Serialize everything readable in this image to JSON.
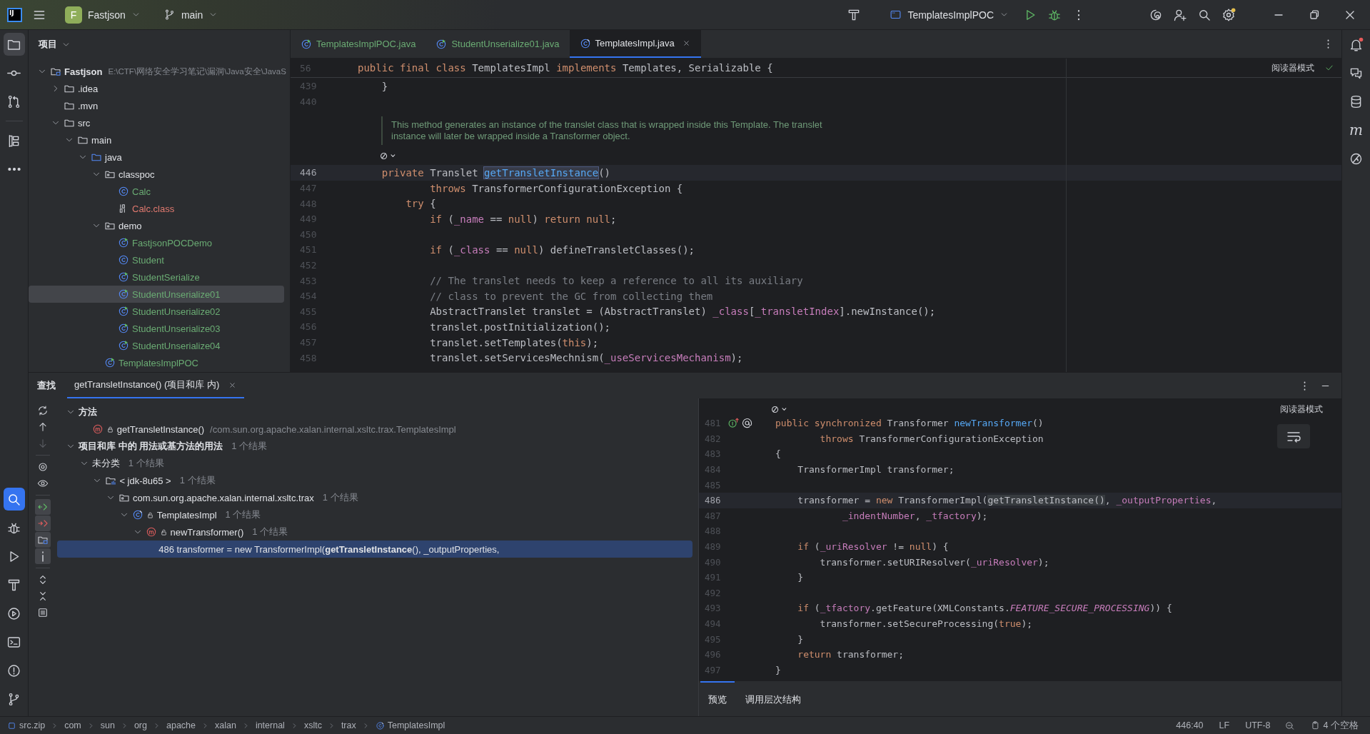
{
  "title_bar": {
    "logo": "IJ",
    "project_initial": "F",
    "project": "Fastjson",
    "branch": "main",
    "run_configuration": "TemplatesImplPOC",
    "settings_badge": true
  },
  "left_toolbar": {
    "top": [
      {
        "kind": "project",
        "selected": true
      },
      {
        "kind": "commit",
        "selected": false
      },
      {
        "kind": "pull-requests",
        "selected": false
      },
      {
        "kind": "structure",
        "selected": false
      },
      {
        "kind": "more",
        "selected": false
      }
    ],
    "bottom": [
      {
        "kind": "find",
        "selected": true
      },
      {
        "kind": "debug",
        "selected": false
      },
      {
        "kind": "run",
        "selected": false
      },
      {
        "kind": "build",
        "selected": false
      },
      {
        "kind": "services",
        "selected": false
      },
      {
        "kind": "terminal",
        "selected": false
      },
      {
        "kind": "problems",
        "selected": false
      },
      {
        "kind": "git",
        "selected": false
      }
    ]
  },
  "project_panel": {
    "title": "项目",
    "tree": [
      {
        "label": "Fastjson",
        "path": "E:\\CTF\\网络安全学习笔记\\漏洞\\Java安全\\JavaS",
        "kind": "module",
        "expanded": true,
        "selected": false,
        "children": [
          {
            "label": ".idea",
            "kind": "folder",
            "expanded": false,
            "selected": false
          },
          {
            "label": ".mvn",
            "kind": "folder",
            "selected": false
          },
          {
            "label": "src",
            "kind": "folder",
            "expanded": true,
            "selected": false,
            "children": [
              {
                "label": "main",
                "kind": "folder",
                "expanded": true,
                "selected": false,
                "children": [
                  {
                    "label": "java",
                    "kind": "source-folder",
                    "expanded": true,
                    "selected": false,
                    "children": [
                      {
                        "label": "classpoc",
                        "kind": "package",
                        "expanded": true,
                        "selected": false,
                        "children": [
                          {
                            "label": "Calc",
                            "kind": "class",
                            "selected": false,
                            "color": "#6aab73"
                          },
                          {
                            "label": "Calc.class",
                            "kind": "binary",
                            "selected": false,
                            "color": "#e0796f"
                          }
                        ]
                      },
                      {
                        "label": "demo",
                        "kind": "package",
                        "expanded": true,
                        "selected": false,
                        "children": [
                          {
                            "label": "FastjsonPOCDemo",
                            "kind": "runnable-class",
                            "selected": false,
                            "color": "#6aab73"
                          },
                          {
                            "label": "Student",
                            "kind": "class",
                            "selected": false,
                            "color": "#6aab73"
                          },
                          {
                            "label": "StudentSerialize",
                            "kind": "runnable-class",
                            "selected": false,
                            "color": "#6aab73"
                          },
                          {
                            "label": "StudentUnserialize01",
                            "kind": "runnable-class",
                            "selected": true,
                            "color": "#6aab73"
                          },
                          {
                            "label": "StudentUnserialize02",
                            "kind": "runnable-class",
                            "selected": false,
                            "color": "#6aab73"
                          },
                          {
                            "label": "StudentUnserialize03",
                            "kind": "runnable-class",
                            "selected": false,
                            "color": "#6aab73"
                          },
                          {
                            "label": "StudentUnserialize04",
                            "kind": "runnable-class",
                            "selected": false,
                            "color": "#6aab73"
                          }
                        ]
                      },
                      {
                        "label": "TemplatesImplPOC",
                        "kind": "runnable-class",
                        "selected": false,
                        "color": "#6aab73"
                      }
                    ]
                  }
                ]
              }
            ]
          }
        ]
      }
    ]
  },
  "editor": {
    "tabs": [
      {
        "label": "TemplatesImplPOC.java",
        "kind": "runnable-class",
        "color": "#6aab73",
        "selected": false
      },
      {
        "label": "StudentUnserialize01.java",
        "kind": "runnable-class",
        "color": "#6aab73",
        "selected": false
      },
      {
        "label": "TemplatesImpl.java",
        "kind": "library-class",
        "selected": true
      }
    ],
    "reader_mode": "阅读器模式",
    "sticky_line": {
      "number": "56",
      "tokens": [
        {
          "text": "public final class ",
          "kind": "keyword"
        },
        {
          "text": "TemplatesImpl ",
          "kind": "plain"
        },
        {
          "text": "implements ",
          "kind": "keyword"
        },
        {
          "text": "Templates, Serializable {",
          "kind": "plain"
        }
      ]
    },
    "lines": [
      {
        "kind": "code",
        "number": "439",
        "current": false,
        "tokens": [
          {
            "text": "    }",
            "kind": "plain"
          }
        ]
      },
      {
        "kind": "code",
        "number": "440",
        "current": false
      },
      {
        "kind": "doc",
        "text": "This method generates an instance of the translet class that is wrapped inside this Template. The translet instance will later be wrapped inside a Transformer object."
      },
      {
        "kind": "code",
        "number": "446",
        "current": true,
        "tokens": [
          {
            "text": "    private ",
            "kind": "keyword"
          },
          {
            "text": "Translet ",
            "kind": "plain"
          },
          {
            "text": "getTransletInstance",
            "kind": "match"
          },
          {
            "text": "()",
            "kind": "plain"
          }
        ]
      },
      {
        "kind": "code",
        "number": "447",
        "current": false,
        "tokens": [
          {
            "text": "            throws ",
            "kind": "keyword"
          },
          {
            "text": "TransformerConfigurationException {",
            "kind": "plain"
          }
        ]
      },
      {
        "kind": "code",
        "number": "448",
        "current": false,
        "tokens": [
          {
            "text": "        try ",
            "kind": "keyword"
          },
          {
            "text": "{",
            "kind": "plain"
          }
        ]
      },
      {
        "kind": "code",
        "number": "449",
        "current": false,
        "tokens": [
          {
            "text": "            if ",
            "kind": "keyword"
          },
          {
            "text": "(",
            "kind": "plain"
          },
          {
            "text": "_name",
            "kind": "field"
          },
          {
            "text": " == ",
            "kind": "plain"
          },
          {
            "text": "null",
            "kind": "keyword"
          },
          {
            "text": ") ",
            "kind": "plain"
          },
          {
            "text": "return null",
            "kind": "keyword"
          },
          {
            "text": ";",
            "kind": "plain"
          }
        ]
      },
      {
        "kind": "code",
        "number": "450",
        "current": false
      },
      {
        "kind": "code",
        "number": "451",
        "current": false,
        "tokens": [
          {
            "text": "            if ",
            "kind": "keyword"
          },
          {
            "text": "(",
            "kind": "plain"
          },
          {
            "text": "_class",
            "kind": "field"
          },
          {
            "text": " == ",
            "kind": "plain"
          },
          {
            "text": "null",
            "kind": "keyword"
          },
          {
            "text": ") defineTransletClasses();",
            "kind": "plain"
          }
        ]
      },
      {
        "kind": "code",
        "number": "452",
        "current": false
      },
      {
        "kind": "code",
        "number": "453",
        "current": false,
        "tokens": [
          {
            "text": "            // The translet needs to keep a reference to all its auxiliary",
            "kind": "comment"
          }
        ]
      },
      {
        "kind": "code",
        "number": "454",
        "current": false,
        "tokens": [
          {
            "text": "            // class to prevent the GC from collecting them",
            "kind": "comment"
          }
        ]
      },
      {
        "kind": "code",
        "number": "455",
        "current": false,
        "tokens": [
          {
            "text": "            AbstractTranslet translet = (AbstractTranslet) ",
            "kind": "plain"
          },
          {
            "text": "_class",
            "kind": "field"
          },
          {
            "text": "[",
            "kind": "plain"
          },
          {
            "text": "_transletIndex",
            "kind": "field"
          },
          {
            "text": "].newInstance();",
            "kind": "plain"
          }
        ]
      },
      {
        "kind": "code",
        "number": "456",
        "current": false,
        "tokens": [
          {
            "text": "            translet.postInitialization();",
            "kind": "plain"
          }
        ]
      },
      {
        "kind": "code",
        "number": "457",
        "current": false,
        "tokens": [
          {
            "text": "            translet.setTemplates(",
            "kind": "plain"
          },
          {
            "text": "this",
            "kind": "keyword"
          },
          {
            "text": ");",
            "kind": "plain"
          }
        ]
      },
      {
        "kind": "code",
        "number": "458",
        "current": false,
        "tokens": [
          {
            "text": "            translet.setServicesMechnism(",
            "kind": "plain"
          },
          {
            "text": "_useServicesMechanism",
            "kind": "field"
          },
          {
            "text": ");",
            "kind": "plain"
          }
        ]
      }
    ]
  },
  "find_panel": {
    "title": "查找",
    "tabs": [
      {
        "label": "getTransletInstance() (项目和库 内)",
        "selected": true
      }
    ],
    "toolbar": [
      {
        "kind": "rerun",
        "on": false,
        "disabled": false
      },
      {
        "kind": "previous",
        "on": false,
        "disabled": false
      },
      {
        "kind": "next",
        "on": false,
        "disabled": true
      },
      {
        "kind": "settings",
        "on": false,
        "disabled": false
      },
      {
        "kind": "preview",
        "on": false,
        "disabled": false
      },
      {
        "kind": "read-access",
        "on": true,
        "disabled": false
      },
      {
        "kind": "write-access",
        "on": true,
        "disabled": false
      },
      {
        "kind": "module",
        "on": true,
        "disabled": false
      },
      {
        "kind": "info",
        "on": true,
        "disabled": false
      },
      {
        "kind": "expand",
        "on": false,
        "disabled": false
      },
      {
        "kind": "collapse",
        "on": false,
        "disabled": false
      },
      {
        "kind": "export",
        "on": false,
        "disabled": false
      }
    ],
    "tree": [
      {
        "label": "方法",
        "kind": "group",
        "expanded": true,
        "selected": false,
        "children": [
          {
            "label": "getTransletInstance()",
            "location": "/com.sun.org.apache.xalan.internal.xsltc.trax.TemplatesImpl",
            "kind": "method",
            "private": true,
            "selected": false
          }
        ]
      },
      {
        "label": "项目和库 中的 用法或基方法的用法",
        "count": "1 个结果",
        "kind": "group",
        "expanded": true,
        "selected": false,
        "children": [
          {
            "label": "未分类",
            "count": "1 个结果",
            "kind": "category",
            "expanded": true,
            "selected": false,
            "children": [
              {
                "label": "< jdk-8u65 >",
                "count": "1 个结果",
                "kind": "library",
                "expanded": true,
                "selected": false,
                "children": [
                  {
                    "label": "com.sun.org.apache.xalan.internal.xsltc.trax",
                    "count": "1 个结果",
                    "kind": "package",
                    "expanded": true,
                    "selected": false,
                    "children": [
                      {
                        "label": "TemplatesImpl",
                        "count": "1 个结果",
                        "kind": "library-class",
                        "private": false,
                        "expanded": true,
                        "selected": false,
                        "children": [
                          {
                            "label": "newTransformer()",
                            "count": "1 个结果",
                            "kind": "method",
                            "private": false,
                            "expanded": true,
                            "selected": false,
                            "children": [
                              {
                                "label": "486 transformer = new TransformerImpl(**getTransletInstance**(), _outputProperties,",
                                "kind": "usage",
                                "selected": true
                              }
                            ]
                          }
                        ]
                      }
                    ]
                  }
                ]
              }
            ]
          }
        ]
      }
    ]
  },
  "preview": {
    "reader_mode": "阅读器模式",
    "lines": [
      {
        "number": "481",
        "current": false,
        "gutter": [
          {
            "kind": "implements"
          },
          {
            "kind": "annotation"
          }
        ],
        "tokens": [
          {
            "text": "public synchronized ",
            "kind": "keyword"
          },
          {
            "text": "Transformer ",
            "kind": "plain"
          },
          {
            "text": "newTransformer",
            "kind": "declaration"
          },
          {
            "text": "()",
            "kind": "plain"
          }
        ]
      },
      {
        "number": "482",
        "current": false,
        "tokens": [
          {
            "text": "        throws ",
            "kind": "keyword"
          },
          {
            "text": "TransformerConfigurationException",
            "kind": "plain"
          }
        ]
      },
      {
        "number": "483",
        "current": false,
        "tokens": [
          {
            "text": "{",
            "kind": "plain"
          }
        ]
      },
      {
        "number": "484",
        "current": false,
        "tokens": [
          {
            "text": "    TransformerImpl transformer;",
            "kind": "plain"
          }
        ]
      },
      {
        "number": "485",
        "current": false
      },
      {
        "number": "486",
        "current": true,
        "tokens": [
          {
            "text": "    transformer = ",
            "kind": "plain"
          },
          {
            "text": "new ",
            "kind": "keyword"
          },
          {
            "text": "TransformerImpl(",
            "kind": "plain"
          },
          {
            "text": "getTransletInstance()",
            "kind": "usage"
          },
          {
            "text": ", ",
            "kind": "plain"
          },
          {
            "text": "_outputProperties",
            "kind": "field"
          },
          {
            "text": ",",
            "kind": "plain"
          }
        ]
      },
      {
        "number": "487",
        "current": false,
        "tokens": [
          {
            "text": "            _indentNumber",
            "kind": "field"
          },
          {
            "text": ", ",
            "kind": "plain"
          },
          {
            "text": "_tfactory",
            "kind": "field"
          },
          {
            "text": ");",
            "kind": "plain"
          }
        ]
      },
      {
        "number": "488",
        "current": false
      },
      {
        "number": "489",
        "current": false,
        "tokens": [
          {
            "text": "    if ",
            "kind": "keyword"
          },
          {
            "text": "(",
            "kind": "plain"
          },
          {
            "text": "_uriResolver",
            "kind": "field"
          },
          {
            "text": " != ",
            "kind": "plain"
          },
          {
            "text": "null",
            "kind": "keyword"
          },
          {
            "text": ") {",
            "kind": "plain"
          }
        ]
      },
      {
        "number": "490",
        "current": false,
        "tokens": [
          {
            "text": "        transformer.setURIResolver(",
            "kind": "plain"
          },
          {
            "text": "_uriResolver",
            "kind": "field"
          },
          {
            "text": ");",
            "kind": "plain"
          }
        ]
      },
      {
        "number": "491",
        "current": false,
        "tokens": [
          {
            "text": "    }",
            "kind": "plain"
          }
        ]
      },
      {
        "number": "492",
        "current": false
      },
      {
        "number": "493",
        "current": false,
        "tokens": [
          {
            "text": "    if ",
            "kind": "keyword"
          },
          {
            "text": "(",
            "kind": "plain"
          },
          {
            "text": "_tfactory",
            "kind": "field"
          },
          {
            "text": ".getFeature(XMLConstants.",
            "kind": "plain"
          },
          {
            "text": "FEATURE_SECURE_PROCESSING",
            "kind": "constant"
          },
          {
            "text": ")) {",
            "kind": "plain"
          }
        ]
      },
      {
        "number": "494",
        "current": false,
        "tokens": [
          {
            "text": "        transformer.setSecureProcessing(",
            "kind": "plain"
          },
          {
            "text": "true",
            "kind": "keyword"
          },
          {
            "text": ");",
            "kind": "plain"
          }
        ]
      },
      {
        "number": "495",
        "current": false,
        "tokens": [
          {
            "text": "    }",
            "kind": "plain"
          }
        ]
      },
      {
        "number": "496",
        "current": false,
        "tokens": [
          {
            "text": "    return ",
            "kind": "keyword"
          },
          {
            "text": "transformer;",
            "kind": "plain"
          }
        ]
      },
      {
        "number": "497",
        "current": false,
        "tokens": [
          {
            "text": "}",
            "kind": "plain"
          }
        ]
      }
    ],
    "tabs": [
      {
        "label": "预览",
        "selected": true
      },
      {
        "label": "调用层次结构",
        "selected": false
      }
    ]
  },
  "status_bar": {
    "breadcrumbs": [
      {
        "label": "src.zip",
        "kind": "archive"
      },
      {
        "label": "com"
      },
      {
        "label": "sun"
      },
      {
        "label": "org"
      },
      {
        "label": "apache"
      },
      {
        "label": "xalan"
      },
      {
        "label": "internal"
      },
      {
        "label": "xsltc"
      },
      {
        "label": "trax"
      },
      {
        "label": "TemplatesImpl",
        "kind": "library-class"
      }
    ],
    "position": "446:40",
    "line_separator": "LF",
    "encoding": "UTF-8",
    "indent": "4 个空格"
  },
  "right_toolbar": [
    {
      "kind": "notifications",
      "badge": true
    },
    {
      "kind": "ai-chat",
      "badge": false
    },
    {
      "kind": "database",
      "badge": false
    },
    {
      "kind": "maven",
      "badge": false,
      "glyph": "m"
    },
    {
      "kind": "copilot",
      "badge": false
    }
  ]
}
